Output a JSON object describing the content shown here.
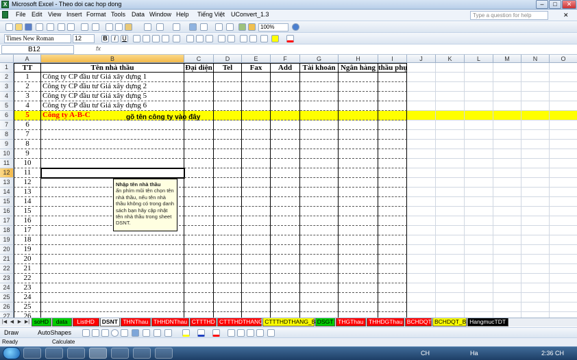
{
  "window": {
    "title": "Microsoft Excel - Theo doi cac hop dong",
    "help_placeholder": "Type a question for help"
  },
  "menu": [
    "File",
    "Edit",
    "View",
    "Insert",
    "Format",
    "Tools",
    "Data",
    "Window",
    "Help",
    "Tiếng Việt",
    "UConvert_1.3"
  ],
  "toolbar": {
    "zoom": "100%",
    "font_name": "Times New Roman",
    "font_size": "12"
  },
  "formula_bar": {
    "name_box": "B12",
    "fx": "fx",
    "content": ""
  },
  "columns": [
    "A",
    "B",
    "C",
    "D",
    "E",
    "F",
    "G",
    "H",
    "I",
    "J",
    "K",
    "L",
    "M",
    "N",
    "O"
  ],
  "headers": [
    "TT",
    "Tên nhà thầu",
    "Đại diện",
    "Tel",
    "Fax",
    "Add",
    "Tài khoản",
    "Ngân hàng",
    "thầu phụ"
  ],
  "rows": [
    {
      "tt": "1",
      "name": "Công ty CP đầu tư Giá xây dựng 1"
    },
    {
      "tt": "2",
      "name": "Công ty CP đầu tư Giá xây dựng 2"
    },
    {
      "tt": "3",
      "name": "Công ty CP đầu tư Giá xây dựng 5"
    },
    {
      "tt": "4",
      "name": "Công ty CP đầu tư Giá xây dựng 6"
    },
    {
      "tt": "5",
      "name": "Công ty A-B-C"
    },
    {
      "tt": "6",
      "name": ""
    },
    {
      "tt": "7",
      "name": ""
    },
    {
      "tt": "8",
      "name": ""
    },
    {
      "tt": "9",
      "name": ""
    },
    {
      "tt": "10",
      "name": ""
    },
    {
      "tt": "11",
      "name": ""
    },
    {
      "tt": "12",
      "name": ""
    },
    {
      "tt": "13",
      "name": ""
    },
    {
      "tt": "14",
      "name": ""
    },
    {
      "tt": "15",
      "name": ""
    },
    {
      "tt": "16",
      "name": ""
    },
    {
      "tt": "17",
      "name": ""
    },
    {
      "tt": "18",
      "name": ""
    },
    {
      "tt": "19",
      "name": ""
    },
    {
      "tt": "20",
      "name": ""
    },
    {
      "tt": "21",
      "name": ""
    },
    {
      "tt": "22",
      "name": ""
    },
    {
      "tt": "23",
      "name": ""
    },
    {
      "tt": "24",
      "name": ""
    },
    {
      "tt": "25",
      "name": ""
    },
    {
      "tt": "26",
      "name": ""
    }
  ],
  "highlight_row_color": "#ffff00",
  "highlight_text_color": "#ff0000",
  "callout": "gõ tên công ty vào đây",
  "validation_note": {
    "title": "Nhập tên nhà thầu",
    "body": "ấn phím mũi tên chọn tên nhà thầu, nếu tên nhà thầu không có trong danh sách bạn hãy cập nhật tên nhà thầu trong sheet DSNT."
  },
  "sheet_tabs": [
    {
      "label": "soHD",
      "color": "#00cc00"
    },
    {
      "label": "data",
      "color": "#00cc00"
    },
    {
      "label": "ListHD",
      "color": "#ff0000"
    },
    {
      "label": "DSNT",
      "color": "#ffffff",
      "active": true
    },
    {
      "label": "THNThau",
      "color": "#ff0000"
    },
    {
      "label": "THHDNThau",
      "color": "#ff0000"
    },
    {
      "label": "CTTTHD",
      "color": "#ff0000"
    },
    {
      "label": "CTTTHDTHANG",
      "color": "#ff0000"
    },
    {
      "label": "CTTTHDTHANG_B",
      "color": "#ffff00"
    },
    {
      "label": "DSGT",
      "color": "#00cc00"
    },
    {
      "label": "THGThau",
      "color": "#ff0000"
    },
    {
      "label": "THHDGThau",
      "color": "#ff0000"
    },
    {
      "label": "BCHDQT",
      "color": "#ff0000"
    },
    {
      "label": "BCHDQT_B",
      "color": "#ffff00"
    },
    {
      "label": "HangmucTDT",
      "color": "#000000"
    }
  ],
  "drawbar": {
    "draw": "Draw",
    "autoshapes": "AutoShapes"
  },
  "status": {
    "left": "Ready",
    "mode": "Calculate"
  },
  "tray": {
    "lang": "CH",
    "time": "2:36 CH",
    "ime": "Ha"
  }
}
